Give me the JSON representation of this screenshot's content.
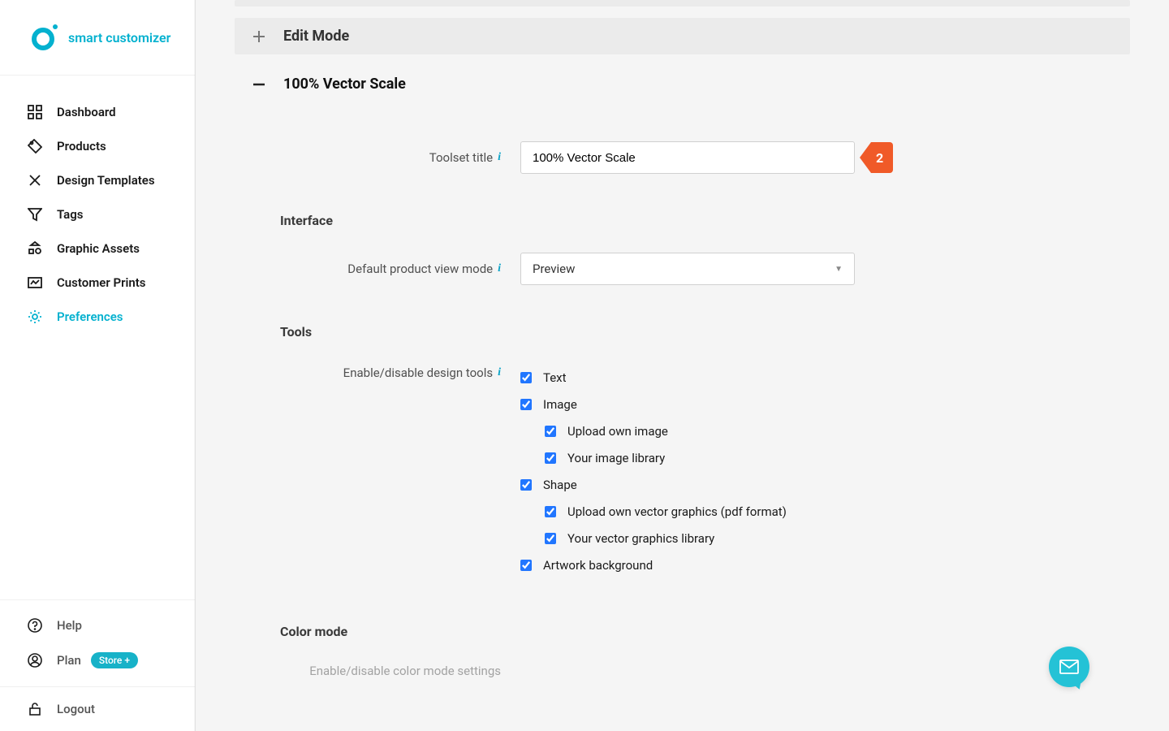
{
  "brand": "smart customizer",
  "sidebar": {
    "items": [
      {
        "label": "Dashboard",
        "icon": "dashboard"
      },
      {
        "label": "Products",
        "icon": "tag"
      },
      {
        "label": "Design Templates",
        "icon": "templates"
      },
      {
        "label": "Tags",
        "icon": "filter"
      },
      {
        "label": "Graphic Assets",
        "icon": "assets"
      },
      {
        "label": "Customer Prints",
        "icon": "prints"
      },
      {
        "label": "Preferences",
        "icon": "gear"
      }
    ],
    "bottom": {
      "help": "Help",
      "plan": "Plan",
      "plan_badge": "Store +",
      "logout": "Logout"
    }
  },
  "panels": {
    "edit_mode": {
      "title": "Edit Mode"
    },
    "vector_scale": {
      "title": "100% Vector Scale"
    }
  },
  "form": {
    "toolset_title": {
      "label": "Toolset title",
      "value": "100% Vector Scale",
      "badge": "2"
    },
    "interface": {
      "heading": "Interface",
      "view_mode": {
        "label": "Default product view mode",
        "value": "Preview"
      }
    },
    "tools": {
      "heading": "Tools",
      "enable_label": "Enable/disable design tools",
      "items": {
        "text": "Text",
        "image": "Image",
        "upload_own_image": "Upload own image",
        "your_image_library": "Your image library",
        "shape": "Shape",
        "upload_vector": "Upload own vector graphics (pdf format)",
        "your_vector_library": "Your vector graphics library",
        "artwork_bg": "Artwork background"
      }
    },
    "color_mode": {
      "heading": "Color mode",
      "enable_label": "Enable/disable color mode settings"
    }
  }
}
